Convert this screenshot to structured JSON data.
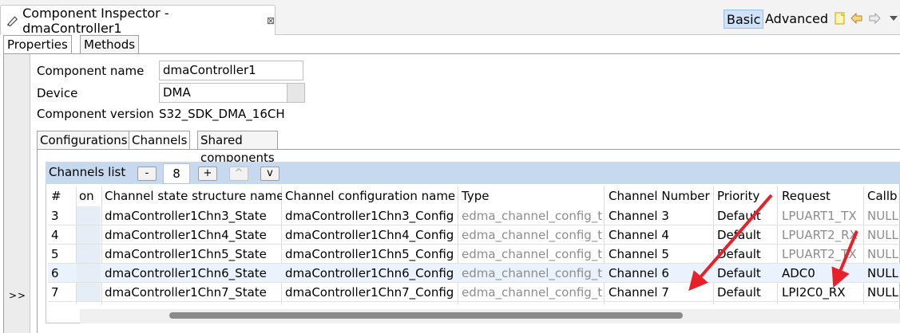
{
  "view": {
    "title": "Component Inspector - dmaController1",
    "close_glyph": "⊠",
    "modes": [
      "Basic",
      "Advanced"
    ]
  },
  "tabs": [
    "Properties",
    "Methods"
  ],
  "side_expand": ">>",
  "component": {
    "name_label": "Component name",
    "name_value": "dmaController1",
    "device_label": "Device",
    "device_value": "DMA",
    "version_label": "Component version",
    "version_value": "S32_SDK_DMA_16CH"
  },
  "inner_tabs": [
    "Configurations",
    "Channels",
    "Shared components"
  ],
  "channels_list": {
    "title": "Channels list",
    "minus": "-",
    "count": "8",
    "plus": "+",
    "up": "^",
    "down": "v"
  },
  "table": {
    "headers": [
      "#",
      "on",
      "Channel state structure name",
      "Channel configuration name",
      "Type",
      "Channel Number",
      "Priority",
      "Request",
      "Callb"
    ],
    "rows": [
      [
        "3",
        "",
        "dmaController1Chn3_State",
        "dmaController1Chn3_Config",
        "edma_channel_config_t",
        "Channel 3",
        "Default",
        "LPUART1_TX",
        "NULL"
      ],
      [
        "4",
        "",
        "dmaController1Chn4_State",
        "dmaController1Chn4_Config",
        "edma_channel_config_t",
        "Channel 4",
        "Default",
        "LPUART2_RX",
        "NULL"
      ],
      [
        "5",
        "",
        "dmaController1Chn5_State",
        "dmaController1Chn5_Config",
        "edma_channel_config_t",
        "Channel 5",
        "Default",
        "LPUART2_TX",
        "NULL"
      ],
      [
        "6",
        "",
        "dmaController1Chn6_State",
        "dmaController1Chn6_Config",
        "edma_channel_config_t",
        "Channel 6",
        "Default",
        "ADC0",
        "NULL"
      ],
      [
        "7",
        "",
        "dmaController1Chn7_State",
        "dmaController1Chn7_Config",
        "edma_channel_config_t",
        "Channel 7",
        "Default",
        "LPI2C0_RX",
        "NULL"
      ]
    ],
    "selected_row": 3
  },
  "colors": {
    "accent": "#c7d9ee",
    "annotation": "#e8202a"
  }
}
